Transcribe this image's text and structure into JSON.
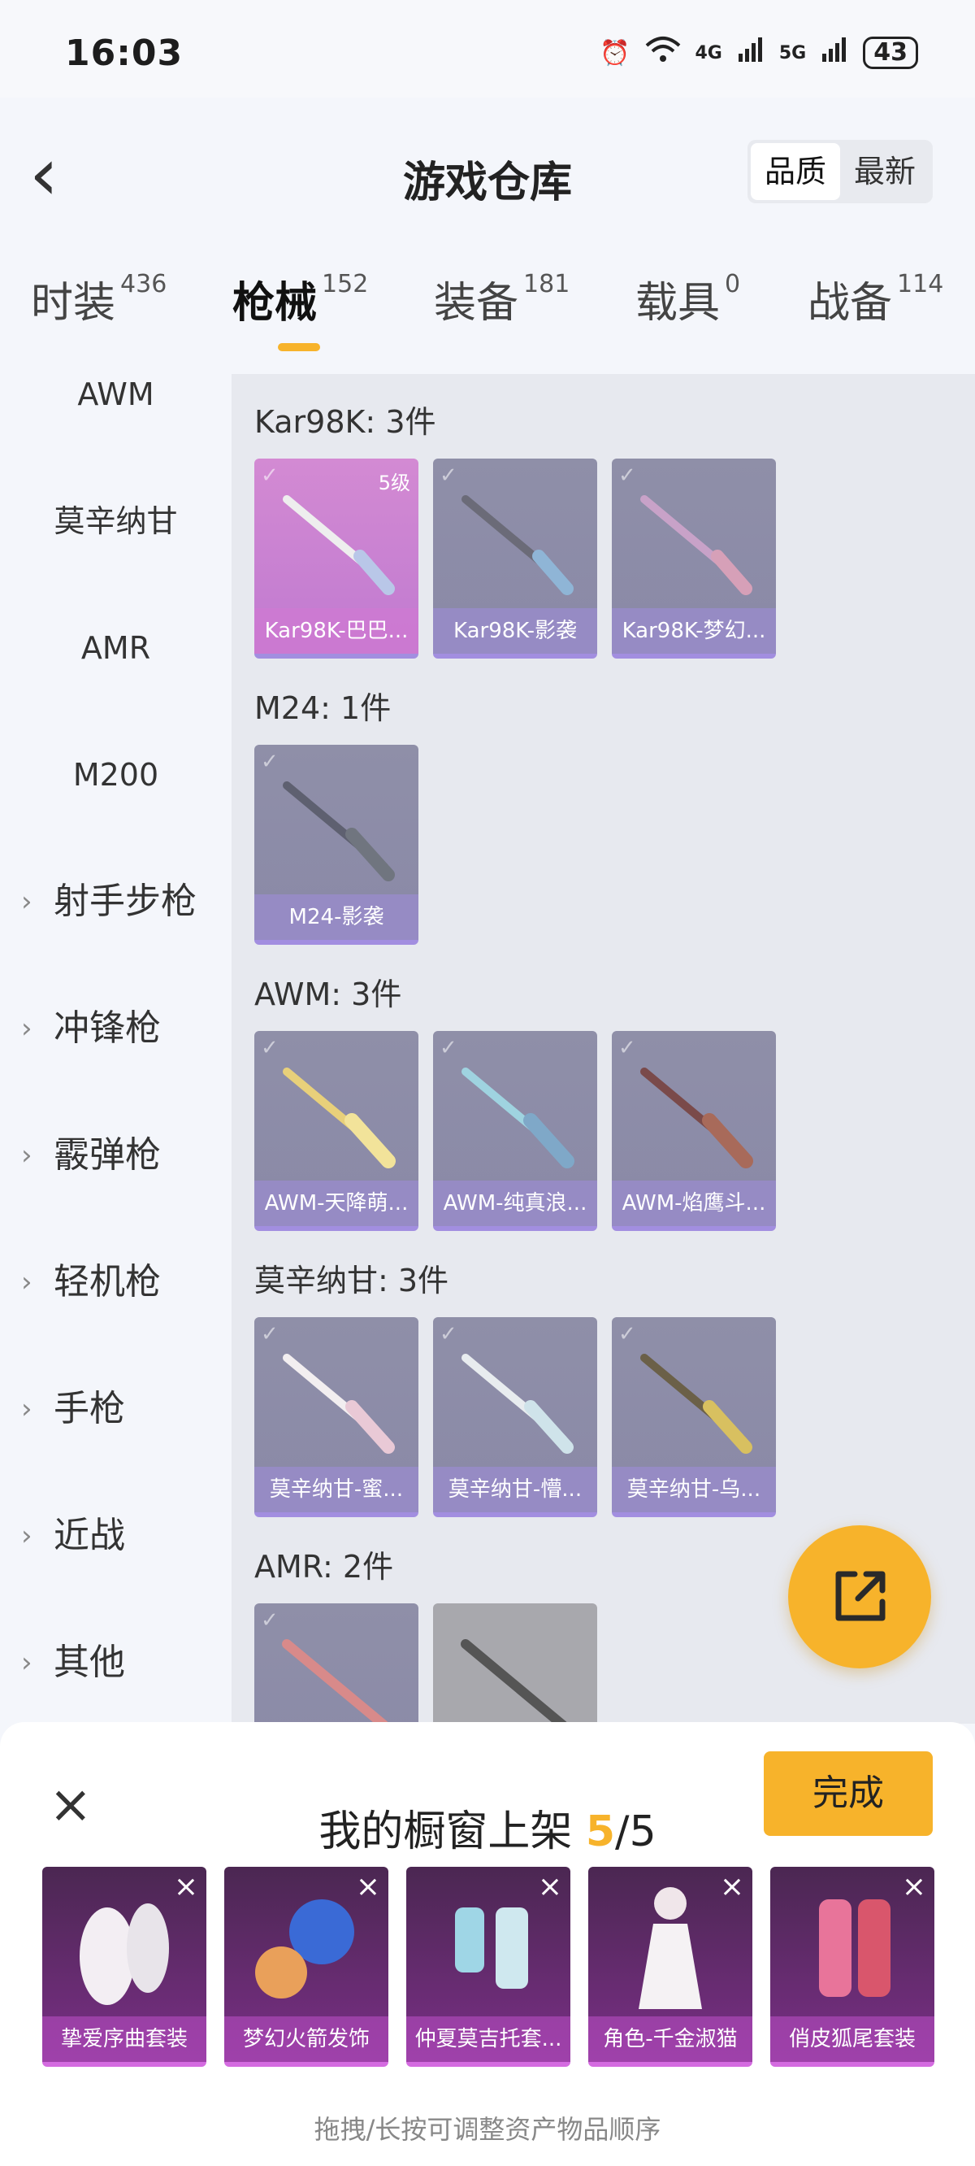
{
  "status_bar": {
    "time": "16:03",
    "network_1": "4G",
    "network_2": "5G",
    "battery": "43"
  },
  "header": {
    "title": "游戏仓库",
    "sort_options": [
      "品质",
      "最新"
    ],
    "active_sort": "品质"
  },
  "tabs": [
    {
      "label": "时装",
      "count": "436"
    },
    {
      "label": "枪械",
      "count": "152"
    },
    {
      "label": "装备",
      "count": "181"
    },
    {
      "label": "载具",
      "count": "0"
    },
    {
      "label": "战备",
      "count": "114"
    }
  ],
  "active_tab": "枪械",
  "sidebar": {
    "sub_items": [
      "AWM",
      "莫辛纳甘",
      "AMR",
      "M200"
    ],
    "groups": [
      "射手步枪",
      "冲锋枪",
      "霰弹枪",
      "轻机枪",
      "手枪",
      "近战",
      "其他"
    ]
  },
  "content": {
    "groups": [
      {
        "title": "Kar98K: 3件",
        "items": [
          "Kar98K-巴巴...",
          "Kar98K-影袭",
          "Kar98K-梦幻..."
        ],
        "badge": "5级"
      },
      {
        "title": "M24: 1件",
        "items": [
          "M24-影袭"
        ]
      },
      {
        "title": "AWM: 3件",
        "items": [
          "AWM-天降萌...",
          "AWM-纯真浪...",
          "AWM-焰鹰斗..."
        ]
      },
      {
        "title": "莫辛纳甘: 3件",
        "items": [
          "莫辛纳甘-蜜...",
          "莫辛纳甘-懵...",
          "莫辛纳甘-乌..."
        ]
      },
      {
        "title": "AMR: 2件",
        "items": [
          "",
          ""
        ]
      }
    ]
  },
  "panel": {
    "title_prefix": "我的橱窗上架",
    "count_current": "5",
    "count_sep": "/",
    "count_total": "5",
    "done_label": "完成",
    "shelf_items": [
      "挚爱序曲套装",
      "梦幻火箭发饰",
      "仲夏莫吉托套...",
      "角色-千金淑猫",
      "俏皮狐尾套装"
    ],
    "hint": "拖拽/长按可调整资产物品顺序"
  },
  "colors": {
    "accent": "#f7b32b",
    "card_rare": "#8a89a7",
    "card_legend": "#c07ad0",
    "shelf": "#7a2f86"
  }
}
